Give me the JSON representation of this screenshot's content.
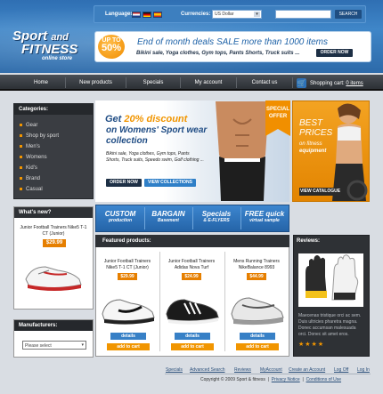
{
  "header": {
    "languages_label": "Languages:",
    "currencies_label": "Currencies:",
    "currency_value": "US Dollar",
    "search_button": "SEARCH",
    "search_value": ""
  },
  "logo": {
    "line1": "Sport",
    "line1b": "and",
    "line2": "FITNESS",
    "tagline": "online store"
  },
  "deal": {
    "badge_top": "UP TO",
    "badge_percent": "50%",
    "headline": "End of month deals SALE more than 1000 items",
    "items": "Bikini sale, Yoga clothes, Gym tops, Pants Shorts, Truck suits ...",
    "order_button": "ORDER NOW"
  },
  "nav": {
    "items": [
      "Home",
      "New products",
      "Specials",
      "My account",
      "Contact us"
    ],
    "cart_label": "Shopping cart:",
    "cart_count": "0 items"
  },
  "categories": {
    "title": "Categories:",
    "items": [
      "Gear",
      "Shop by sport",
      "Men's",
      "Womens",
      "Kid's",
      "Brand",
      "Casual"
    ]
  },
  "whats_new": {
    "title": "What's new?",
    "product_name": "Junior Football Trainers Nike5 T-1 CT (Junior)",
    "price": "$29.99"
  },
  "manufacturers": {
    "title": "Manufacturers:",
    "select_value": "Please select"
  },
  "hero": {
    "headline_prefix": "Get",
    "headline_percent": "20% discount",
    "headline_line2": "on Womens' Sport wear",
    "headline_line3": "collection",
    "description": "Bikini sale, Yoga clothes, Gym tops, Pants Shorts, Truck suits, Speedo swim, Golf clothing ...",
    "order_button": "ORDER NOW",
    "collections_button": "VIEW COLLECTIONS",
    "ribbon": "SPECIAL OFFER"
  },
  "promo": {
    "line1": "BEST",
    "line2": "PRICES",
    "line3": "on fitness",
    "line4": "equipment",
    "button": "VIEW CATALOGUE"
  },
  "tabs": [
    {
      "title": "CUSTOM",
      "sub": "production"
    },
    {
      "title": "BARGAIN",
      "sub": "Basement"
    },
    {
      "title": "Specials",
      "sub": "& E-FLYERS"
    },
    {
      "title": "FREE quick",
      "sub": "virtual sample"
    }
  ],
  "featured": {
    "title": "Featured products:",
    "products": [
      {
        "name": "Junior Football Trainers Nike5 T-1 CT (Junior)",
        "price": "$29.99",
        "details": "details",
        "cart": "add to cart"
      },
      {
        "name": "Junior Football Trainers Adidas Nova Turf",
        "price": "$24.99",
        "details": "details",
        "cart": "add to cart"
      },
      {
        "name": "Mens Running Trainers NikeBalance 8993",
        "price": "$44.99",
        "details": "details",
        "cart": "add to cart"
      }
    ]
  },
  "reviews": {
    "title": "Reviews:",
    "text": "Maecenas tristique orci ac sem. Duis ultricies pharetra magna. Donec accumsan malesuada orci. Donec sit amet eros.",
    "stars": "★★★★"
  },
  "footer": {
    "links": [
      "Specials",
      "Advanced Search",
      "Reviews",
      "MyAccount",
      "Create an Account",
      "Log Off",
      "Log In"
    ],
    "copyright": "Copyright © 2009 Sport & fitness",
    "privacy": "Privacy Notice",
    "conditions": "Conditions of Use"
  },
  "colors": {
    "brand_blue": "#2f6fb3",
    "accent_orange": "#f19500",
    "nav_dark": "#2c3035"
  }
}
